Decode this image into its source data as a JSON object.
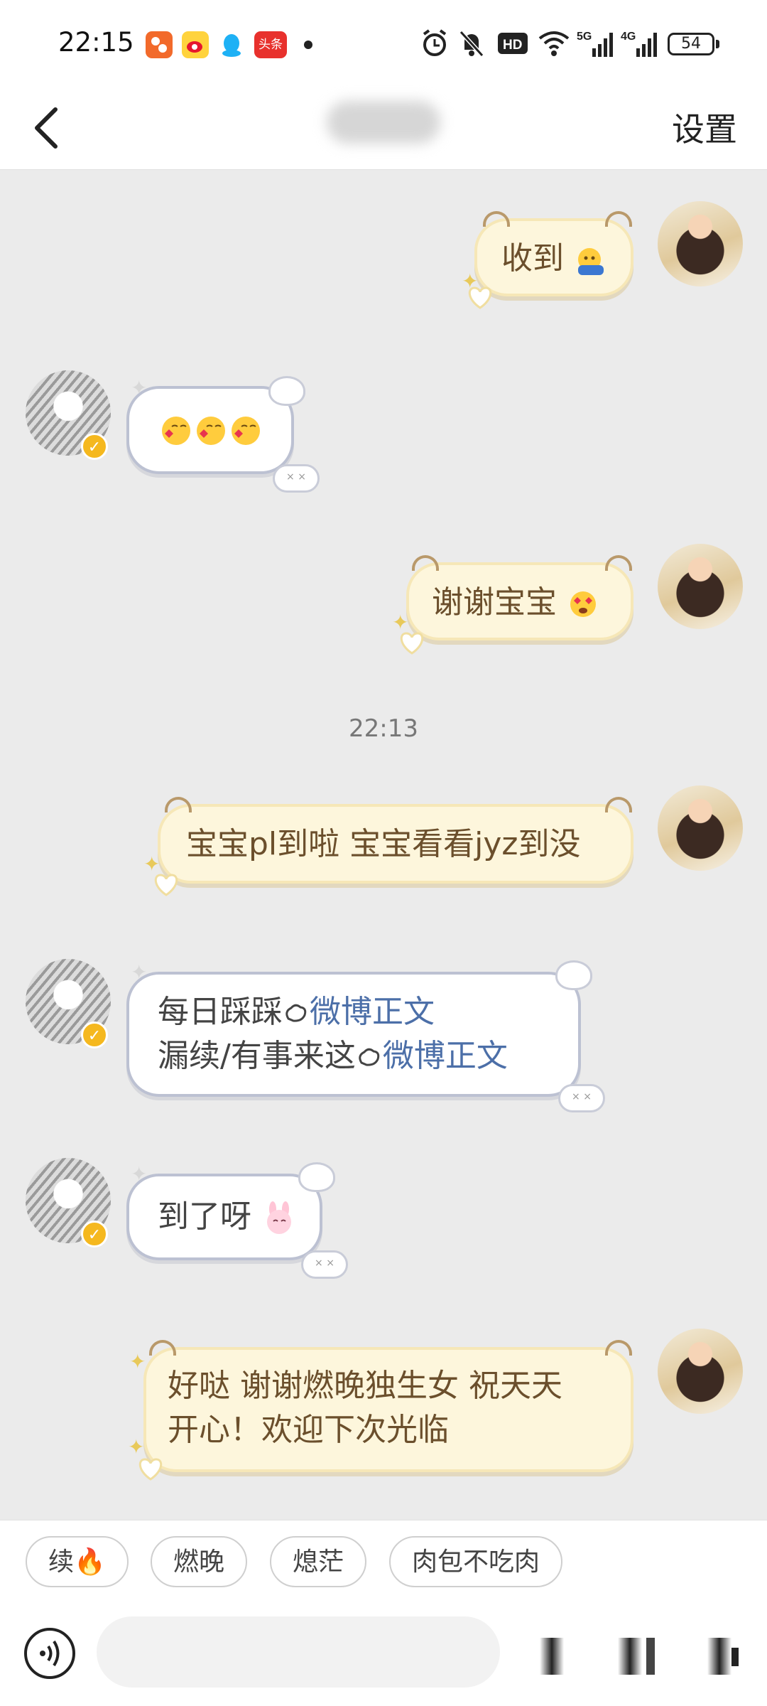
{
  "status_bar": {
    "time": "22:15",
    "battery_level": "54",
    "network_labels": [
      "HD",
      "5G",
      "4G"
    ],
    "notification_icons": [
      "app-icon",
      "weibo-icon",
      "qq-icon",
      "toutiao-icon"
    ],
    "notification_toutiao_text": "头条",
    "system_icons": [
      "alarm-icon",
      "mute-icon",
      "hd-icon",
      "wifi-icon",
      "signal-5g-icon",
      "signal-4g-icon",
      "battery-icon"
    ]
  },
  "nav": {
    "title": "",
    "settings_label": "设置"
  },
  "chat": {
    "timestamp": "22:13",
    "messages": [
      {
        "side": "self",
        "text": "收到",
        "emoji": "salute-face"
      },
      {
        "side": "other",
        "text": "",
        "emoji": "kissing-heart x3"
      },
      {
        "side": "self",
        "text": "谢谢宝宝",
        "emoji": "heart-eyes-face"
      },
      {
        "side": "self",
        "text": "宝宝pl到啦 宝宝看看jyz到没"
      },
      {
        "side": "other",
        "line1_text": "每日踩踩",
        "line1_link": "微博正文",
        "line2_text": "漏续/有事来这",
        "line2_link": "微博正文"
      },
      {
        "side": "other",
        "text": "到了呀",
        "emoji": "rabbit-face"
      },
      {
        "side": "self",
        "line1": "好哒 谢谢燃晚独生女 祝天天",
        "line2": "开心！欢迎下次光临"
      }
    ]
  },
  "quick_replies": [
    "续🔥",
    "燃晚",
    "熄茫",
    "肉包不吃肉"
  ],
  "input": {
    "placeholder": ""
  },
  "colors": {
    "self_bubble_bg": "#fdf6dc",
    "self_bubble_text": "#6b4f2c",
    "other_bubble_border": "#bcc1d2",
    "link": "#4c6fa8",
    "verified_badge": "#f5b81e",
    "chat_bg": "#ebebeb"
  }
}
